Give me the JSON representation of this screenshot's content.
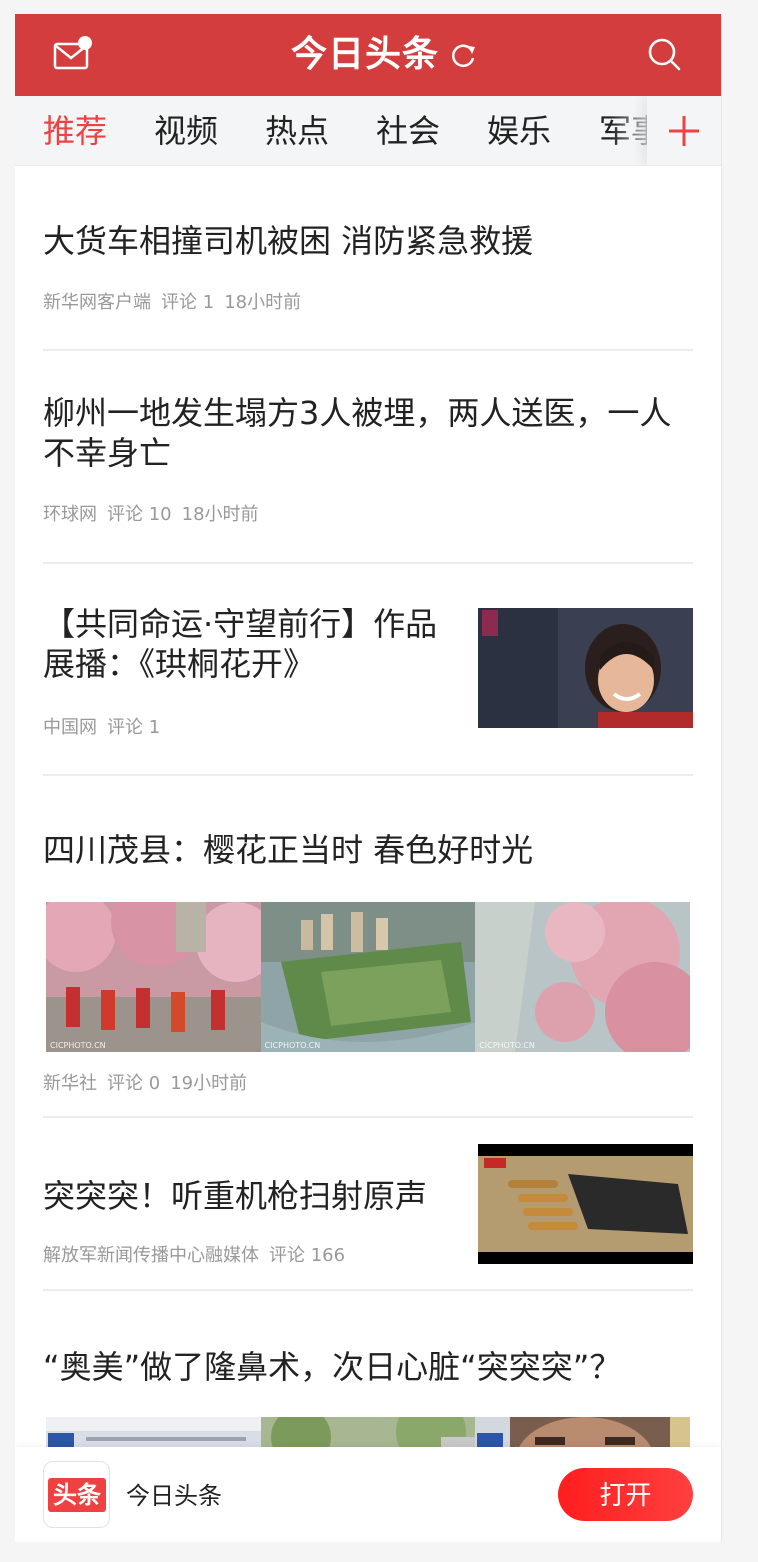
{
  "header": {
    "logo_text": "今日头条",
    "mail_icon": "mail-icon",
    "refresh_icon": "refresh-icon",
    "search_icon": "search-icon"
  },
  "tabs": [
    {
      "label": "推荐",
      "active": true
    },
    {
      "label": "视频",
      "active": false
    },
    {
      "label": "热点",
      "active": false
    },
    {
      "label": "社会",
      "active": false
    },
    {
      "label": "娱乐",
      "active": false
    },
    {
      "label": "军事",
      "active": false
    }
  ],
  "add_channel_icon": "plus-icon",
  "feed": [
    {
      "title": "大货车相撞司机被困 消防紧急救援",
      "source": "新华网客户端",
      "comments": "评论 1",
      "time": "18小时前"
    },
    {
      "title": "柳州一地发生塌方3人被埋，两人送医，一人不幸身亡",
      "source": "环球网",
      "comments": "评论 10",
      "time": "18小时前"
    },
    {
      "title": "【共同命运·守望前行】作品展播：《珙桐花开》",
      "source": "中国网",
      "comments": "评论 1",
      "time": ""
    },
    {
      "title": "四川茂县：樱花正当时 春色好时光",
      "source": "新华社",
      "comments": "评论 0",
      "time": "19小时前"
    },
    {
      "title": "突突突！听重机枪扫射原声",
      "source": "解放军新闻传播中心融媒体",
      "comments": "评论 166",
      "time": ""
    },
    {
      "title": "“奥美”做了隆鼻术，次日心脏“突突突”？",
      "source": "",
      "comments": "",
      "time": ""
    }
  ],
  "bottom_bar": {
    "icon_text": "头条",
    "app_name": "今日头条",
    "open_label": "打开"
  },
  "colors": {
    "brand_red": "#d43d3d",
    "active_tab": "#f04142",
    "open_button": "#ff2b2b"
  }
}
